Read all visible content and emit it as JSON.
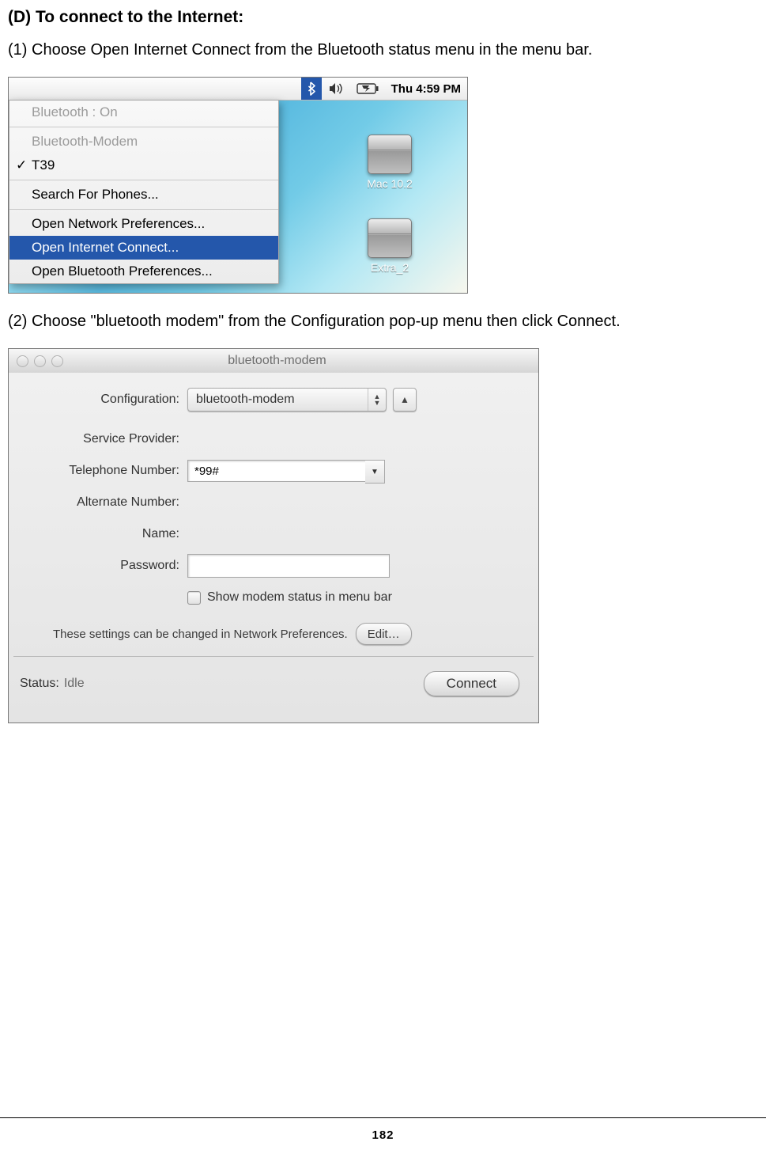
{
  "doc": {
    "heading": "(D) To connect to the Internet:",
    "step1": "(1) Choose Open Internet Connect from the Bluetooth status menu in the menu bar.",
    "step2": "(2) Choose \"bluetooth modem\" from the Configuration pop-up menu then click Connect.",
    "page_number": "182"
  },
  "fig1": {
    "menubar": {
      "time": "Thu 4:59 PM"
    },
    "menu": {
      "header": "Bluetooth : On",
      "section_label": "Bluetooth-Modem",
      "device": "T39",
      "search": "Search For Phones...",
      "open_network": "Open Network Preferences...",
      "open_internet": "Open Internet Connect...",
      "open_bt_prefs": "Open Bluetooth Preferences..."
    },
    "drives": {
      "d1": "Mac 10.2",
      "d2": "Extra_2"
    }
  },
  "fig2": {
    "title": "bluetooth-modem",
    "labels": {
      "configuration": "Configuration:",
      "service_provider": "Service Provider:",
      "telephone": "Telephone Number:",
      "alternate": "Alternate Number:",
      "name": "Name:",
      "password": "Password:",
      "show_status": "Show modem status in menu bar",
      "note": "These settings can be changed in Network Preferences.",
      "edit": "Edit…",
      "status_label": "Status:",
      "status_value": "Idle",
      "connect": "Connect"
    },
    "values": {
      "configuration": "bluetooth-modem",
      "telephone": "*99#"
    }
  }
}
